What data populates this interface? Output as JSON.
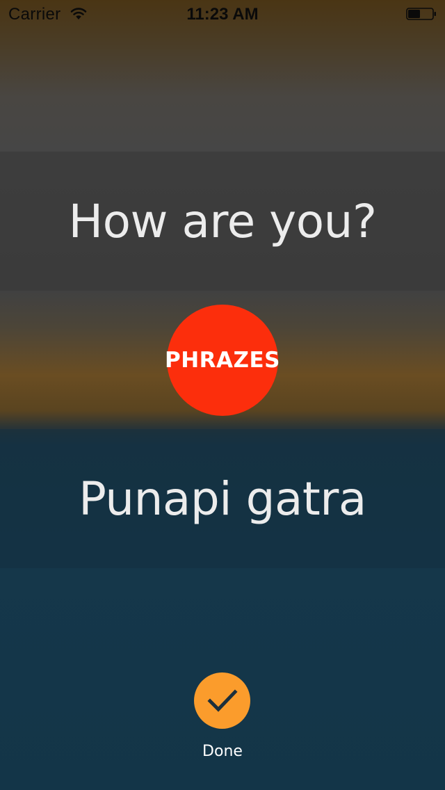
{
  "status_bar": {
    "carrier": "Carrier",
    "time": "11:23 AM",
    "wifi_icon": "wifi-icon",
    "battery_icon": "battery-icon",
    "battery_level": 0.5
  },
  "phrase": {
    "question": "How are you?",
    "answer": "Punapi gatra"
  },
  "logo": {
    "label": "PHRAZES",
    "color": "#fc2e0c"
  },
  "done": {
    "label": "Done",
    "icon": "checkmark-icon",
    "color": "#fb9c2c"
  }
}
